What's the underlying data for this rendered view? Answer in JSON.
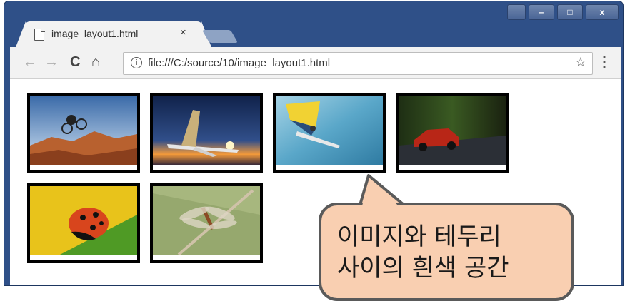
{
  "window": {
    "controls": [
      "_",
      "–",
      "□",
      "x"
    ]
  },
  "tab": {
    "title": "image_layout1.html",
    "close_label": "×",
    "page_icon": "page-icon"
  },
  "toolbar": {
    "back": "←",
    "forward": "→",
    "reload": "C",
    "home": "⌂",
    "url": "file:///C:/source/10/image_layout1.html",
    "info": "i",
    "star": "☆",
    "menu": "⋮"
  },
  "images": [
    {
      "name": "bmx-rider-photo",
      "colors": [
        "#3a6aa8",
        "#9fc2e4",
        "#b8612f"
      ]
    },
    {
      "name": "airplane-sunset-photo",
      "colors": [
        "#10224a",
        "#314f8a",
        "#f39a3a"
      ]
    },
    {
      "name": "windsurfer-photo",
      "colors": [
        "#5aa7c9",
        "#2f7ba2",
        "#a7d4e6"
      ]
    },
    {
      "name": "red-car-photo",
      "colors": [
        "#1e2e14",
        "#3a5a22",
        "#b82617"
      ]
    },
    {
      "name": "ladybug-photo",
      "colors": [
        "#e8c31b",
        "#4f9a25",
        "#d8451d"
      ]
    },
    {
      "name": "dragonfly-photo",
      "colors": [
        "#a7b77e",
        "#7d9058",
        "#8b4b25"
      ]
    }
  ],
  "callout": {
    "line1": "이미지와 테두리",
    "line2": "사이의 흰색 공간",
    "fill": "#f9cfb1",
    "border": "#5a5a5a"
  }
}
